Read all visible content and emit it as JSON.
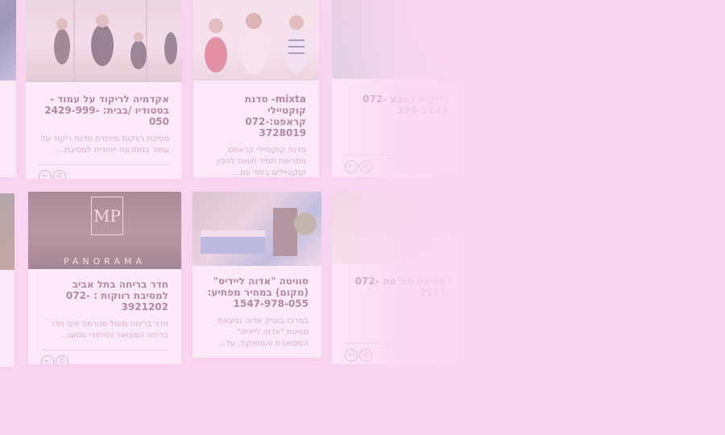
{
  "cards": [
    {
      "title": "אקדמיה לריקוד על עמוד - בסטודיו /בבית: 2429-999-050",
      "desc": "מסיבת רווקות מיוחדת סדנת ריקוד על עמוד במתכונת ייחודית למסיבת...",
      "photo_alt": "pole dance group"
    },
    {
      "title": "mixta- סדנת קוקטיילי קראפט:072-3728019",
      "desc": "סדנת קוקטיילי קראפט מסריפת תמיד חוויות להכין קוקטיילים ביחד עם...",
      "photo_alt": "cocktail workshop"
    },
    {
      "title": "רווקות בטבע 072-393-1234",
      "desc": "",
      "photo_alt": "pool"
    },
    {
      "title": "חדר בריחה בתל אביב למסיבת רווקות : 072-3921202",
      "desc": "חדר בריחה מוטל פנורמה הינו חדר בריחה המפואר והייחודי מסוגו...",
      "photo_alt": "MP hotel panorama",
      "logo_text": "MP",
      "logo_sub": "PANORAMA"
    },
    {
      "title": "סוויטה \"אדוה ליידיס\"(מקום) במחיר מפתיע: 1547-978-055",
      "desc": "במרכז בוטיק אדוה נמצאת סוויטת \"אדוה ליידיס\" המפוארת והמפנקת, על...",
      "photo_alt": "suite room"
    },
    {
      "title": "מסיבת פיג׳מה 072-2211",
      "desc": "",
      "photo_alt": "party"
    }
  ],
  "icons": {
    "arrow": "←",
    "phone": "✆"
  }
}
